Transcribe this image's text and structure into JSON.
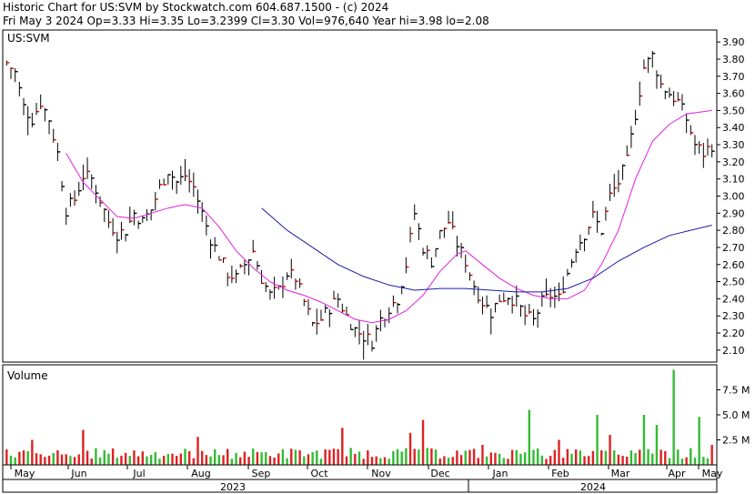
{
  "header": {
    "line1": "Historic Chart for US:SVM by Stockwatch.com 604.687.1500 - (c) 2024",
    "line2": "Fri May  3 2024  Op=3.33  Hi=3.35  Lo=3.2399  Cl=3.30  Vol=976,640  Year hi=3.98  lo=2.08"
  },
  "chart_data": {
    "type": "ohlc",
    "symbol_label": "US:SVM",
    "volume_label": "Volume",
    "price_ticks": [
      "3.90",
      "3.80",
      "3.70",
      "3.60",
      "3.50",
      "3.40",
      "3.30",
      "3.20",
      "3.10",
      "3.00",
      "2.90",
      "2.80",
      "2.70",
      "2.60",
      "2.50",
      "2.40",
      "2.30",
      "2.20",
      "2.10"
    ],
    "price_range": [
      2.03,
      3.97
    ],
    "volume_ticks": [
      "7.5 M",
      "5.0 M",
      "2.5 M"
    ],
    "volume_range_m": [
      0,
      10
    ],
    "month_labels": [
      "May",
      "Jun",
      "Jul",
      "Aug",
      "Sep",
      "Oct",
      "Nov",
      "Dec",
      "Jan",
      "Feb",
      "Mar",
      "Apr",
      "May"
    ],
    "year_labels": [
      "2023",
      "2024"
    ],
    "close_path": [
      [
        0,
        3.78
      ],
      [
        2,
        3.72
      ],
      [
        4,
        3.52
      ],
      [
        6,
        3.45
      ],
      [
        8,
        3.55
      ],
      [
        10,
        3.45
      ],
      [
        12,
        3.25
      ],
      [
        14,
        2.92
      ],
      [
        16,
        2.98
      ],
      [
        18,
        3.12
      ],
      [
        20,
        3.1
      ],
      [
        22,
        2.98
      ],
      [
        24,
        2.85
      ],
      [
        26,
        2.78
      ],
      [
        28,
        2.8
      ],
      [
        30,
        2.9
      ],
      [
        32,
        2.85
      ],
      [
        34,
        2.92
      ],
      [
        36,
        3.05
      ],
      [
        38,
        3.15
      ],
      [
        40,
        3.08
      ],
      [
        42,
        3.12
      ],
      [
        44,
        3.05
      ],
      [
        46,
        2.9
      ],
      [
        48,
        2.75
      ],
      [
        50,
        2.65
      ],
      [
        52,
        2.55
      ],
      [
        54,
        2.52
      ],
      [
        56,
        2.6
      ],
      [
        58,
        2.68
      ],
      [
        60,
        2.52
      ],
      [
        62,
        2.42
      ],
      [
        64,
        2.45
      ],
      [
        66,
        2.55
      ],
      [
        68,
        2.52
      ],
      [
        70,
        2.38
      ],
      [
        72,
        2.25
      ],
      [
        74,
        2.28
      ],
      [
        76,
        2.35
      ],
      [
        78,
        2.4
      ],
      [
        80,
        2.3
      ],
      [
        82,
        2.22
      ],
      [
        84,
        2.18
      ],
      [
        86,
        2.15
      ],
      [
        88,
        2.28
      ],
      [
        90,
        2.35
      ],
      [
        92,
        2.4
      ],
      [
        94,
        2.6
      ],
      [
        96,
        2.9
      ],
      [
        98,
        2.7
      ],
      [
        100,
        2.62
      ],
      [
        102,
        2.78
      ],
      [
        104,
        2.85
      ],
      [
        106,
        2.72
      ],
      [
        108,
        2.62
      ],
      [
        110,
        2.48
      ],
      [
        112,
        2.38
      ],
      [
        114,
        2.32
      ],
      [
        116,
        2.4
      ],
      [
        118,
        2.42
      ],
      [
        120,
        2.38
      ],
      [
        122,
        2.3
      ],
      [
        124,
        2.27
      ],
      [
        126,
        2.38
      ],
      [
        128,
        2.42
      ],
      [
        130,
        2.4
      ],
      [
        132,
        2.55
      ],
      [
        134,
        2.7
      ],
      [
        136,
        2.78
      ],
      [
        138,
        2.88
      ],
      [
        140,
        2.8
      ],
      [
        142,
        3.0
      ],
      [
        144,
        3.08
      ],
      [
        146,
        3.2
      ],
      [
        148,
        3.48
      ],
      [
        150,
        3.75
      ],
      [
        152,
        3.82
      ],
      [
        154,
        3.65
      ],
      [
        156,
        3.6
      ],
      [
        158,
        3.55
      ],
      [
        160,
        3.45
      ],
      [
        162,
        3.3
      ],
      [
        164,
        3.25
      ],
      [
        166,
        3.3
      ]
    ],
    "ma_short": [
      [
        14,
        3.25
      ],
      [
        18,
        3.08
      ],
      [
        22,
        2.98
      ],
      [
        26,
        2.88
      ],
      [
        30,
        2.87
      ],
      [
        34,
        2.9
      ],
      [
        38,
        2.93
      ],
      [
        42,
        2.95
      ],
      [
        46,
        2.93
      ],
      [
        50,
        2.82
      ],
      [
        54,
        2.68
      ],
      [
        58,
        2.58
      ],
      [
        62,
        2.5
      ],
      [
        66,
        2.45
      ],
      [
        70,
        2.42
      ],
      [
        74,
        2.38
      ],
      [
        78,
        2.33
      ],
      [
        82,
        2.28
      ],
      [
        86,
        2.26
      ],
      [
        90,
        2.28
      ],
      [
        94,
        2.33
      ],
      [
        98,
        2.42
      ],
      [
        102,
        2.56
      ],
      [
        106,
        2.66
      ],
      [
        108,
        2.68
      ],
      [
        112,
        2.6
      ],
      [
        116,
        2.52
      ],
      [
        120,
        2.46
      ],
      [
        124,
        2.42
      ],
      [
        128,
        2.4
      ],
      [
        132,
        2.4
      ],
      [
        136,
        2.45
      ],
      [
        140,
        2.6
      ],
      [
        144,
        2.8
      ],
      [
        148,
        3.1
      ],
      [
        152,
        3.32
      ],
      [
        156,
        3.42
      ],
      [
        160,
        3.48
      ],
      [
        166,
        3.5
      ]
    ],
    "ma_long": [
      [
        60,
        2.93
      ],
      [
        66,
        2.8
      ],
      [
        72,
        2.7
      ],
      [
        78,
        2.6
      ],
      [
        84,
        2.53
      ],
      [
        90,
        2.48
      ],
      [
        96,
        2.45
      ],
      [
        102,
        2.46
      ],
      [
        108,
        2.46
      ],
      [
        114,
        2.45
      ],
      [
        120,
        2.44
      ],
      [
        126,
        2.44
      ],
      [
        132,
        2.46
      ],
      [
        138,
        2.52
      ],
      [
        144,
        2.62
      ],
      [
        150,
        2.7
      ],
      [
        156,
        2.77
      ],
      [
        166,
        2.83
      ]
    ],
    "volume_spikes": [
      [
        6,
        2.5
      ],
      [
        18,
        3.5
      ],
      [
        45,
        2.8
      ],
      [
        79,
        3.7
      ],
      [
        95,
        3.2
      ],
      [
        98,
        4.5
      ],
      [
        112,
        2.0
      ],
      [
        123,
        5.5
      ],
      [
        130,
        2.5
      ],
      [
        139,
        5.0
      ],
      [
        142,
        3.0
      ],
      [
        150,
        5.0
      ],
      [
        153,
        4.0
      ],
      [
        157,
        9.5
      ],
      [
        163,
        4.8
      ],
      [
        166,
        2.0
      ]
    ]
  },
  "colors": {
    "up_bar": "#000000",
    "down_tick": "#cc0000",
    "ma_short": "#e020e0",
    "ma_long": "#1a1aa8",
    "vol_up": "#33bb33",
    "vol_down": "#dd2222"
  }
}
